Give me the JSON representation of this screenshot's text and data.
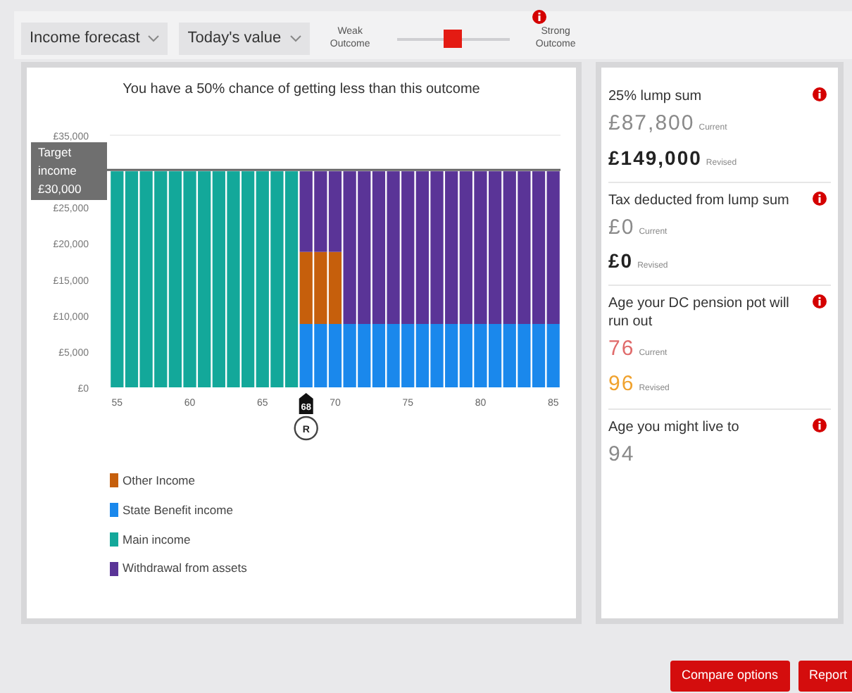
{
  "toolbar": {
    "dropdowns": [
      {
        "label": "Income forecast"
      },
      {
        "label": "Today's value"
      }
    ],
    "outcome_slider": {
      "min_label": "Weak Outcome",
      "max_label": "Strong Outcome",
      "level": 0.5
    }
  },
  "chart_panel": {
    "title": "You have a 50% chance of getting less than this outcome",
    "chart_data": {
      "type": "bar",
      "stacked": true,
      "x": [
        55,
        56,
        57,
        58,
        59,
        60,
        61,
        62,
        63,
        64,
        65,
        66,
        67,
        68,
        69,
        70,
        71,
        72,
        73,
        74,
        75,
        76,
        77,
        78,
        79,
        80,
        81,
        82,
        83,
        84,
        85
      ],
      "series": [
        {
          "name": "Main income",
          "color": "#13a89a",
          "values": [
            30000,
            30000,
            30000,
            30000,
            30000,
            30000,
            30000,
            30000,
            30000,
            30000,
            30000,
            30000,
            30000,
            0,
            0,
            0,
            0,
            0,
            0,
            0,
            0,
            0,
            0,
            0,
            0,
            0,
            0,
            0,
            0,
            0,
            0
          ]
        },
        {
          "name": "State Benefit income",
          "color": "#1a88ec",
          "values": [
            0,
            0,
            0,
            0,
            0,
            0,
            0,
            0,
            0,
            0,
            0,
            0,
            0,
            8800,
            8800,
            8800,
            8800,
            8800,
            8800,
            8800,
            8800,
            8800,
            8800,
            8800,
            8800,
            8800,
            8800,
            8800,
            8800,
            8800,
            8800
          ]
        },
        {
          "name": "Other Income",
          "color": "#c65f0c",
          "values": [
            0,
            0,
            0,
            0,
            0,
            0,
            0,
            0,
            0,
            0,
            0,
            0,
            0,
            10000,
            10000,
            10000,
            0,
            0,
            0,
            0,
            0,
            0,
            0,
            0,
            0,
            0,
            0,
            0,
            0,
            0,
            0
          ]
        },
        {
          "name": "Withdrawal from assets",
          "color": "#5a3497",
          "values": [
            0,
            0,
            0,
            0,
            0,
            0,
            0,
            0,
            0,
            0,
            0,
            0,
            0,
            11200,
            11200,
            11200,
            21200,
            21200,
            21200,
            21200,
            21200,
            21200,
            21200,
            21200,
            21200,
            21200,
            21200,
            21200,
            21200,
            21200,
            21200
          ]
        }
      ],
      "xticks": [
        55,
        60,
        65,
        70,
        75,
        80,
        85
      ],
      "xlim": [
        54.5,
        85.5
      ],
      "yticks": [
        {
          "value": 0,
          "label": "£0"
        },
        {
          "value": 5000,
          "label": "£5,000"
        },
        {
          "value": 10000,
          "label": "£10,000"
        },
        {
          "value": 15000,
          "label": "£15,000"
        },
        {
          "value": 20000,
          "label": "£20,000"
        },
        {
          "value": 25000,
          "label": "£25,000"
        },
        {
          "value": 35000,
          "label": "£35,000"
        }
      ],
      "ylim": [
        0,
        35000
      ],
      "ref_lines": [
        {
          "axis": "y",
          "value": 30000,
          "label": "Target income £30,000"
        }
      ]
    },
    "retirement_marker": {
      "age": "68",
      "badge": "R"
    }
  },
  "summary": [
    {
      "title": "25% lump sum",
      "values": [
        {
          "value": "£87,800",
          "label": "Current",
          "kind": "current"
        },
        {
          "value": "£149,000",
          "label": "Revised",
          "kind": "revised"
        }
      ]
    },
    {
      "title": "Tax deducted from lump sum",
      "values": [
        {
          "value": "£0",
          "label": "Current",
          "kind": "current"
        },
        {
          "value": "£0",
          "label": "Revised",
          "kind": "revised"
        }
      ]
    },
    {
      "title": "Age your DC pension pot will run out",
      "values": [
        {
          "value": "76",
          "label": "Current",
          "kind": "current",
          "color": "#e06b6b"
        },
        {
          "value": "96",
          "label": "Revised",
          "kind": "current",
          "color": "#f0a22e"
        }
      ]
    },
    {
      "title": "Age you might live to",
      "values": [
        {
          "value": "94",
          "kind": "current"
        }
      ]
    }
  ],
  "buttons": [
    {
      "label": "Compare options"
    },
    {
      "label": "Report"
    }
  ]
}
